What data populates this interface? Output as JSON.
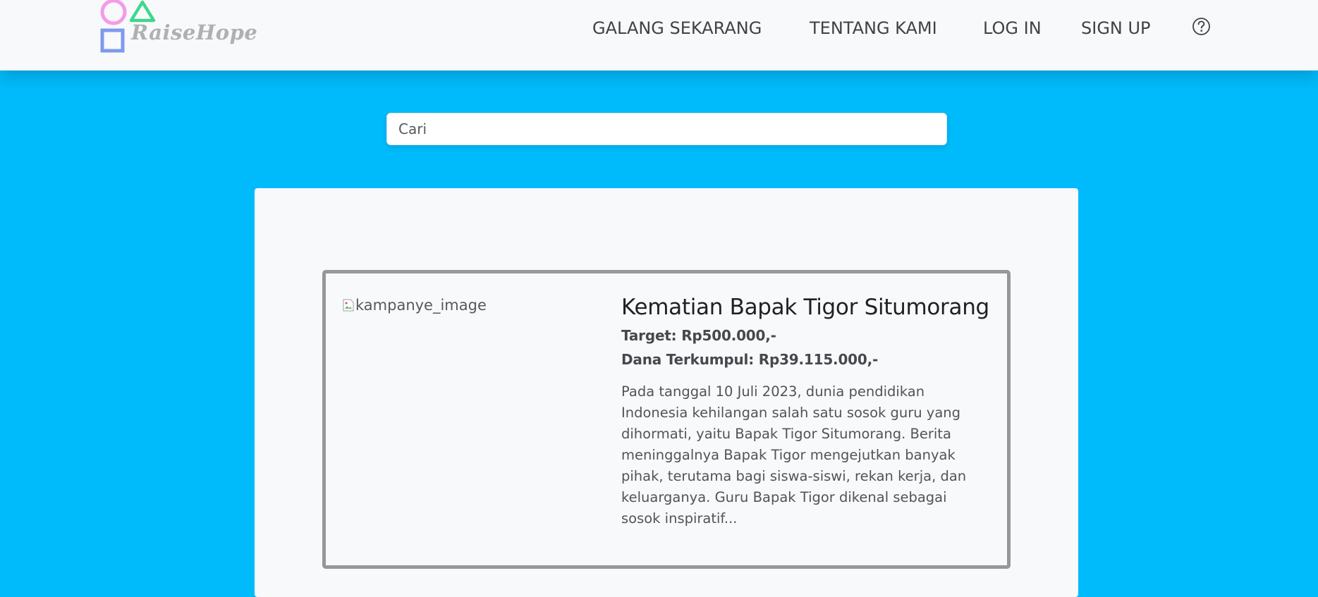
{
  "brand": {
    "name": "RaiseHope",
    "colors": {
      "circle": "#f49ae8",
      "triangle": "#3fd68e",
      "square": "#7f9aee"
    }
  },
  "nav": {
    "items": [
      {
        "label": "GALANG SEKARANG"
      },
      {
        "label": "TENTANG KAMI"
      },
      {
        "label": "LOG IN"
      },
      {
        "label": "SIGN UP"
      }
    ],
    "help_icon": "question-circle-icon"
  },
  "search": {
    "placeholder": "Cari",
    "value": ""
  },
  "campaign": {
    "image_alt": "kampanye_image",
    "title": "Kematian Bapak Tigor Situmorang",
    "target": "Target: Rp500.000,-",
    "collected": "Dana Terkumpul: Rp39.115.000,-",
    "description": "Pada tanggal 10 Juli 2023, dunia pendidikan Indonesia kehilangan salah satu sosok guru yang dihormati, yaitu Bapak Tigor Situmorang. Berita meninggalnya Bapak Tigor mengejutkan banyak pihak, terutama bagi siswa-siswi, rekan kerja, dan keluarganya. Guru Bapak Tigor dikenal sebagai sosok inspiratif..."
  },
  "colors": {
    "page_background": "#00bbfb",
    "navbar": "#f8f9fa",
    "card_border": "#979797"
  }
}
